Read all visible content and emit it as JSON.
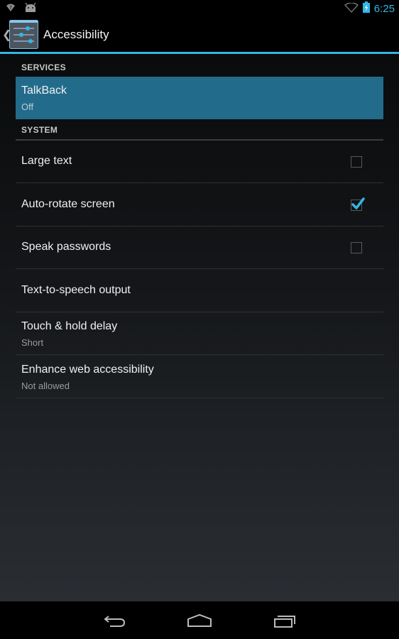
{
  "status_bar": {
    "left_icons": [
      "wifi-question-icon",
      "android-icon"
    ],
    "right_icons": [
      "wifi-icon",
      "battery-charging-icon"
    ],
    "time": "6:25"
  },
  "action_bar": {
    "up_icon": "chevron-left-icon",
    "app_icon": "settings-sliders-icon",
    "title": "Accessibility"
  },
  "sections": [
    {
      "header": "SERVICES",
      "items": [
        {
          "title": "TalkBack",
          "summary": "Off",
          "selected": true
        }
      ]
    },
    {
      "header": "SYSTEM",
      "items": [
        {
          "title": "Large text",
          "checkbox": true,
          "checked": false
        },
        {
          "title": "Auto-rotate screen",
          "checkbox": true,
          "checked": true
        },
        {
          "title": "Speak passwords",
          "checkbox": true,
          "checked": false
        },
        {
          "title": "Text-to-speech output"
        },
        {
          "title": "Touch & hold delay",
          "summary": "Short"
        },
        {
          "title": "Enhance web accessibility",
          "summary": "Not allowed"
        }
      ]
    }
  ],
  "nav_bar": {
    "buttons": [
      "back-icon",
      "home-icon",
      "recent-apps-icon"
    ]
  },
  "colors": {
    "accent": "#33b5e5",
    "selected_row": "#236b8a"
  }
}
